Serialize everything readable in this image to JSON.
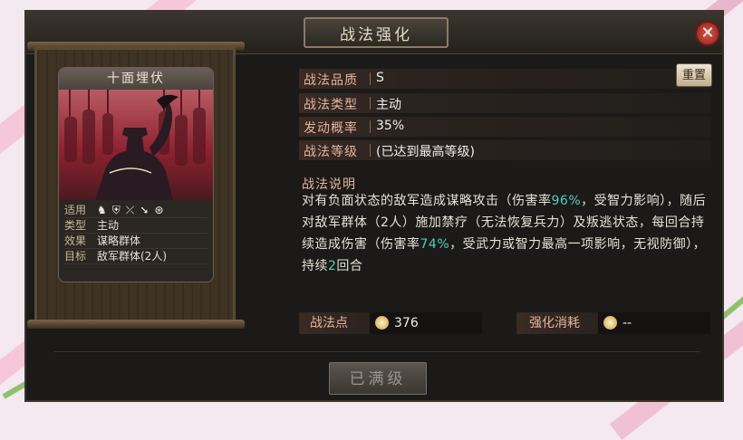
{
  "window": {
    "title": "战法强化",
    "close_glyph": "✕"
  },
  "card": {
    "name": "十面埋伏",
    "info": [
      {
        "key": "适用",
        "value": ""
      },
      {
        "key": "类型",
        "value": "主动"
      },
      {
        "key": "效果",
        "value": "谋略群体"
      },
      {
        "key": "目标",
        "value": "敌军群体(2人)"
      }
    ],
    "applicable_icons": [
      "cavalry-icon",
      "shield-icon",
      "bow-icon",
      "spear-icon",
      "vehicle-icon"
    ]
  },
  "fields": [
    {
      "label": "战法品质",
      "value": "S"
    },
    {
      "label": "战法类型",
      "value": "主动"
    },
    {
      "label": "发动概率",
      "value": "35%"
    },
    {
      "label": "战法等级",
      "value": "(已达到最高等级)"
    }
  ],
  "reset_label": "重置",
  "description": {
    "title": "战法说明",
    "p1": "对有负面状态的敌军造成谋略攻击（伤害率",
    "h1": "96%",
    "p2": "，受智力影响），随后对敌军群体（2人）施加禁疗（无法恢复兵力）及叛逃状态，每回合持续造成伤害（伤害率",
    "h2": "74%",
    "p3": "，受武力或智力最高一项影响，无视防御），持续",
    "h3": "2",
    "p4": "回合"
  },
  "points": {
    "label": "战法点",
    "value": "376"
  },
  "cost": {
    "label": "强化消耗",
    "value": "--"
  },
  "max_button": "已满级",
  "colors": {
    "highlight": "#4fd0b8",
    "label": "#e3b59c",
    "close": "#c0392b"
  }
}
